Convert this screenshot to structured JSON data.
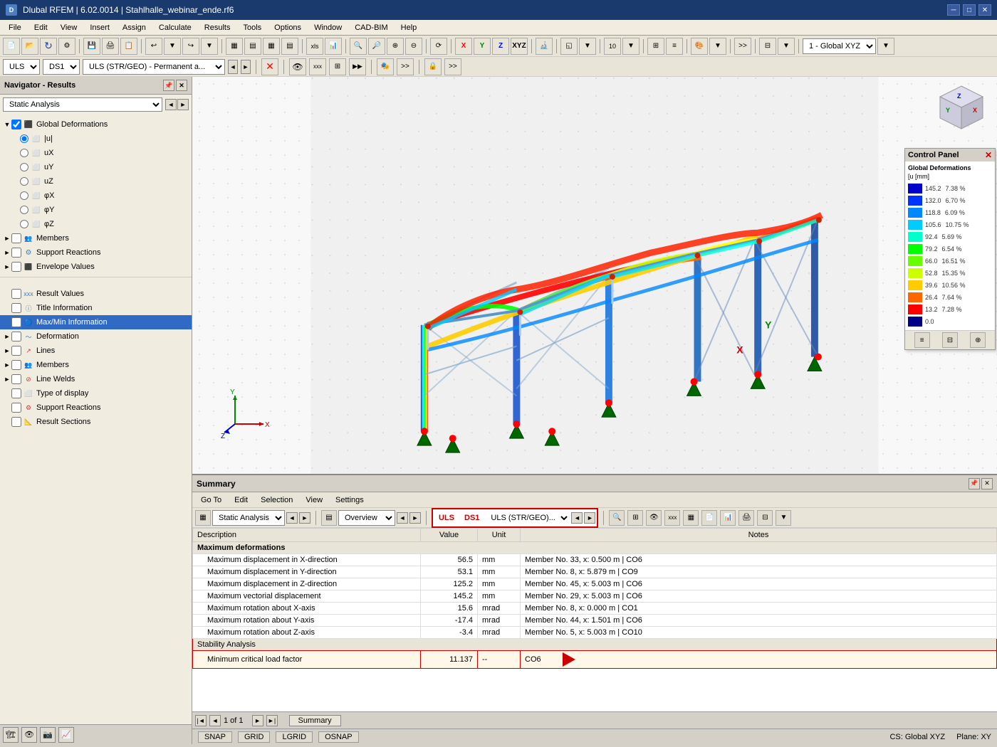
{
  "titlebar": {
    "title": "Dlubal RFEM | 6.02.0014 | Stahlhalle_webinar_ende.rf6",
    "icon": "D"
  },
  "menubar": {
    "items": [
      "File",
      "Edit",
      "View",
      "Insert",
      "Assign",
      "Calculate",
      "Results",
      "Tools",
      "Options",
      "Window",
      "CAD-BIM",
      "Help"
    ]
  },
  "loadcase": {
    "uls": "ULS",
    "ds": "DS1",
    "description": "ULS (STR/GEO) - Permanent a...",
    "global_xyz": "1 - Global XYZ"
  },
  "sidebar": {
    "title": "Navigator - Results",
    "filter": "Static Analysis",
    "tree": {
      "global_deformations": {
        "label": "Global Deformations",
        "children": [
          {
            "id": "u_abs",
            "label": "|u|",
            "selected": true
          },
          {
            "id": "ux",
            "label": "uX"
          },
          {
            "id": "uy",
            "label": "uY"
          },
          {
            "id": "uz",
            "label": "uZ"
          },
          {
            "id": "phix",
            "label": "φX"
          },
          {
            "id": "phiy",
            "label": "φY"
          },
          {
            "id": "phiz",
            "label": "φZ"
          }
        ]
      },
      "members": {
        "label": "Members"
      },
      "support_reactions": {
        "label": "Support Reactions"
      },
      "envelope_values": {
        "label": "Envelope Values"
      }
    },
    "results_section": {
      "items": [
        {
          "id": "result_values",
          "label": "Result Values"
        },
        {
          "id": "title_information",
          "label": "Title Information"
        },
        {
          "id": "max_min_information",
          "label": "Max/Min Information",
          "selected": true
        },
        {
          "id": "deformation",
          "label": "Deformation"
        },
        {
          "id": "lines",
          "label": "Lines"
        },
        {
          "id": "members",
          "label": "Members"
        },
        {
          "id": "line_welds",
          "label": "Line Welds"
        },
        {
          "id": "type_of_display",
          "label": "Type of display"
        },
        {
          "id": "support_reactions",
          "label": "Support Reactions"
        },
        {
          "id": "result_sections",
          "label": "Result Sections"
        }
      ]
    }
  },
  "summary_panel": {
    "title": "Summary",
    "menus": [
      "Go To",
      "Edit",
      "Selection",
      "View",
      "Settings"
    ],
    "toolbar": {
      "analysis": "Static Analysis",
      "overview": "Overview",
      "uls": "ULS",
      "ds1": "DS1",
      "uls_desc": "ULS (STR/GEO)..."
    },
    "table": {
      "headers": [
        "Description",
        "Value",
        "Unit",
        "Notes"
      ],
      "sections": [
        {
          "type": "section_header",
          "label": "Maximum deformations"
        },
        {
          "type": "row",
          "description": "Maximum displacement in X-direction",
          "value": "56.5",
          "unit": "mm",
          "notes": "Member No. 33, x: 0.500 m | CO6"
        },
        {
          "type": "row",
          "description": "Maximum displacement in Y-direction",
          "value": "53.1",
          "unit": "mm",
          "notes": "Member No. 8, x: 5.879 m | CO9"
        },
        {
          "type": "row",
          "description": "Maximum displacement in Z-direction",
          "value": "125.2",
          "unit": "mm",
          "notes": "Member No. 45, x: 5.003 m | CO6"
        },
        {
          "type": "row",
          "description": "Maximum vectorial displacement",
          "value": "145.2",
          "unit": "mm",
          "notes": "Member No. 29, x: 5.003 m | CO6"
        },
        {
          "type": "row",
          "description": "Maximum rotation about X-axis",
          "value": "15.6",
          "unit": "mrad",
          "notes": "Member No. 8, x: 0.000 m | CO1"
        },
        {
          "type": "row",
          "description": "Maximum rotation about Y-axis",
          "value": "-17.4",
          "unit": "mrad",
          "notes": "Member No. 44, x: 1.501 m | CO6"
        },
        {
          "type": "row",
          "description": "Maximum rotation about Z-axis",
          "value": "-3.4",
          "unit": "mrad",
          "notes": "Member No. 5, x: 5.003 m | CO10"
        },
        {
          "type": "stability_header",
          "label": "Stability Analysis"
        },
        {
          "type": "stability_row",
          "description": "Minimum critical load factor",
          "value": "11.137",
          "unit": "--",
          "notes": "CO6",
          "highlighted": true
        }
      ]
    },
    "pagination": {
      "current": "1",
      "total": "1",
      "tab": "Summary"
    }
  },
  "control_panel": {
    "title": "Control Panel",
    "section": "Global Deformations",
    "unit": "[u [mm]",
    "legend": [
      {
        "value": "145.2",
        "pct": "7.38 %",
        "color": "#0000cc"
      },
      {
        "value": "132.0",
        "pct": "6.70 %",
        "color": "#0033ff"
      },
      {
        "value": "118.8",
        "pct": "6.09 %",
        "color": "#0088ff"
      },
      {
        "value": "105.6",
        "pct": "10.75 %",
        "color": "#00ccff"
      },
      {
        "value": "92.4",
        "pct": "5.69 %",
        "color": "#00ffcc"
      },
      {
        "value": "79.2",
        "pct": "6.54 %",
        "color": "#00ff00"
      },
      {
        "value": "66.0",
        "pct": "16.51 %",
        "color": "#66ff00"
      },
      {
        "value": "52.8",
        "pct": "15.35 %",
        "color": "#ccff00"
      },
      {
        "value": "39.6",
        "pct": "10.56 %",
        "color": "#ffcc00"
      },
      {
        "value": "26.4",
        "pct": "7.64 %",
        "color": "#ff6600"
      },
      {
        "value": "13.2",
        "pct": "7.28 %",
        "color": "#ff0000"
      },
      {
        "value": "0.0",
        "pct": "",
        "color": "#000088"
      }
    ]
  },
  "statusbar": {
    "snap": "SNAP",
    "grid": "GRID",
    "lgrid": "LGRID",
    "osnap": "OSNAP",
    "cs": "CS: Global XYZ",
    "plane": "Plane: XY"
  },
  "icons": {
    "expand": "▶",
    "collapse": "▼",
    "check_filled": "☑",
    "check_empty": "☐",
    "radio_filled": "●",
    "radio_empty": "○",
    "folder": "📁",
    "minimize": "─",
    "maximize": "□",
    "close": "✕",
    "nav_left": "◄",
    "nav_right": "►",
    "nav_first": "◄◄",
    "nav_last": "►►"
  }
}
